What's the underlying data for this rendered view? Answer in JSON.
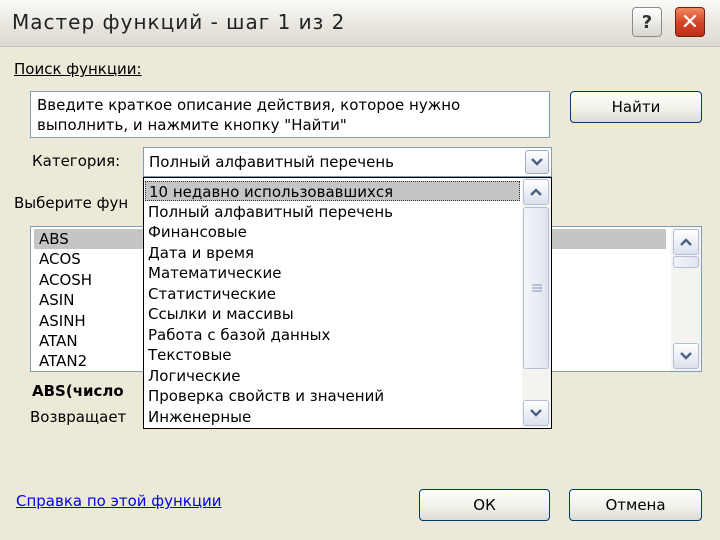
{
  "window": {
    "title": "Мастер функций - шаг 1 из 2",
    "help_glyph": "?",
    "close_glyph": "✕"
  },
  "search": {
    "label": "Поиск функции:",
    "hint": "Введите краткое описание действия, которое нужно выполнить, и нажмите кнопку \"Найти\"",
    "find_button": "Найти"
  },
  "category": {
    "label": "Категория:",
    "selected": "Полный алфавитный перечень",
    "options": [
      "10 недавно использовавшихся",
      "Полный алфавитный перечень",
      "Финансовые",
      "Дата и время",
      "Математические",
      "Статистические",
      "Ссылки и массивы",
      "Работа с базой данных",
      "Текстовые",
      "Логические",
      "Проверка свойств и значений",
      "Инженерные"
    ],
    "highlighted_option": "10 недавно использовавшихся"
  },
  "functions": {
    "label": "Выберите фун",
    "items": [
      "ABS",
      "ACOS",
      "ACOSH",
      "ASIN",
      "ASINH",
      "ATAN",
      "ATAN2"
    ],
    "selected": "ABS"
  },
  "signature": "ABS(число",
  "description": "Возвращает",
  "help_link": "Справка по этой функции",
  "buttons": {
    "ok": "ОК",
    "cancel": "Отмена"
  },
  "colors": {
    "dialog_bg": "#ece9d8",
    "selection": "#c5c5c5",
    "link": "#0000ee",
    "close_button": "#d4472a"
  }
}
